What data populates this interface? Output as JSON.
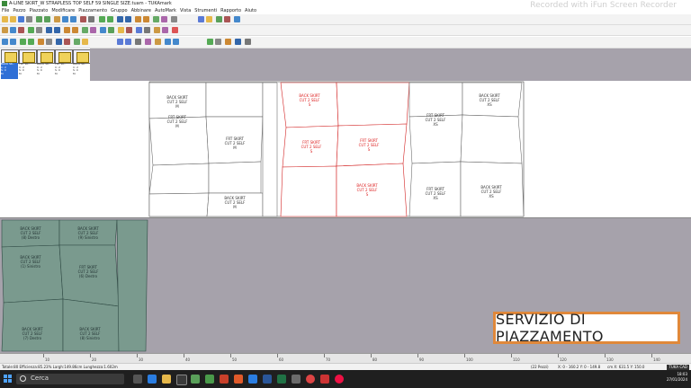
{
  "window": {
    "title": "A-LINE SKIRT_W STRAPLESS TOP SELF 59 SINGLE SIZE.tuam - TUKAmark",
    "watermark": "Recorded with iFun Screen Recorder"
  },
  "menu": [
    "File",
    "Pezzo",
    "Piazzato",
    "Modificare",
    "Piazzamento",
    "Gruppo",
    "Abbinare",
    "AutoMark",
    "Vista",
    "Strumenti",
    "Rapporto",
    "Aiuto"
  ],
  "palette": {
    "pieces": [
      {
        "lines": [
          "BACK SK..",
          "C: 2",
          "S: 0",
          "M"
        ]
      },
      {
        "lines": [
          "FRT SK..",
          "C: 2",
          "S: 0",
          "M"
        ]
      },
      {
        "lines": [
          "BACK SK..",
          "C: 2",
          "S: 0",
          "M"
        ]
      },
      {
        "lines": [
          "FRT SK..",
          "C: 2",
          "S: 0",
          "M"
        ]
      },
      {
        "lines": [
          "BACK SK..",
          "C: 2",
          "S: 0",
          "M"
        ]
      }
    ]
  },
  "marker": {
    "labels": [
      "BACK SKIRT",
      "CUT 2 SELF",
      "M",
      "FRT SKIRT",
      "CUT 2 SELF",
      "M",
      "BACK SKIRT",
      "CUT 2 SELF",
      "S",
      "FRT SKIRT",
      "CUT 2 SELF",
      "S",
      "BACK SKIRT",
      "CUT 2 SELF",
      "XS",
      "FRT SKIRT",
      "CUT 2 SELF",
      "XS",
      "FRT SKIRT",
      "CUT 2 SELF",
      "XS",
      "BACK SKIRT",
      "CUT 2 SELF",
      "XS",
      "FRT SKIRT",
      "CUT 2 SELF",
      "M",
      "BACK SKIRT",
      "CUT 2 SELF",
      "M",
      "FRT SKIRT",
      "CUT 2 SELF",
      "S",
      "BACK SKIRT",
      "CUT 2 SELF",
      "S"
    ]
  },
  "unplaced": {
    "labels": [
      "BACK SKIRT",
      "CUT 2 SELF",
      "(8) Destro",
      "BACK SKIRT",
      "CUT 2 SELF",
      "(9) Sinistro",
      "BACK SKIRT",
      "CUT 2 SELF",
      "(1) Sinistro",
      "FRT SKIRT",
      "CUT 2 SELF",
      "(6) Destro",
      "BACK SKIRT",
      "CUT 2 SELF",
      "(7) Destro",
      "BACK SKIRT",
      "CUT 2 SELF",
      "(8) Sinistro"
    ]
  },
  "service": {
    "text": "SERVIZIO DI PIAZZAMENTO"
  },
  "ruler": {
    "numbers": [
      "10",
      "20",
      "30",
      "40",
      "50",
      "60",
      "70",
      "80",
      "90",
      "100",
      "110",
      "120",
      "130",
      "140"
    ]
  },
  "status": {
    "left": "Totale:80  Efficienza:85.23%  Largh:149.86cm  Lunghezza:1.602m",
    "pieces": "(22 Pezzi)",
    "coords": "X: 0 - 160.2  Y: 0 - 149.8",
    "units": "cm  X: 631.5  Y: 150.0",
    "logo": "TUKA CAD"
  },
  "taskbar": {
    "search_label": "Cerca",
    "time": "18:03",
    "date": "27/01/2024"
  },
  "colors": {
    "accent_orange": "#e0883a",
    "selected_red": "#d22222",
    "unplaced_fill": "#7a9a8e",
    "work_gray": "#a6a2ab"
  }
}
